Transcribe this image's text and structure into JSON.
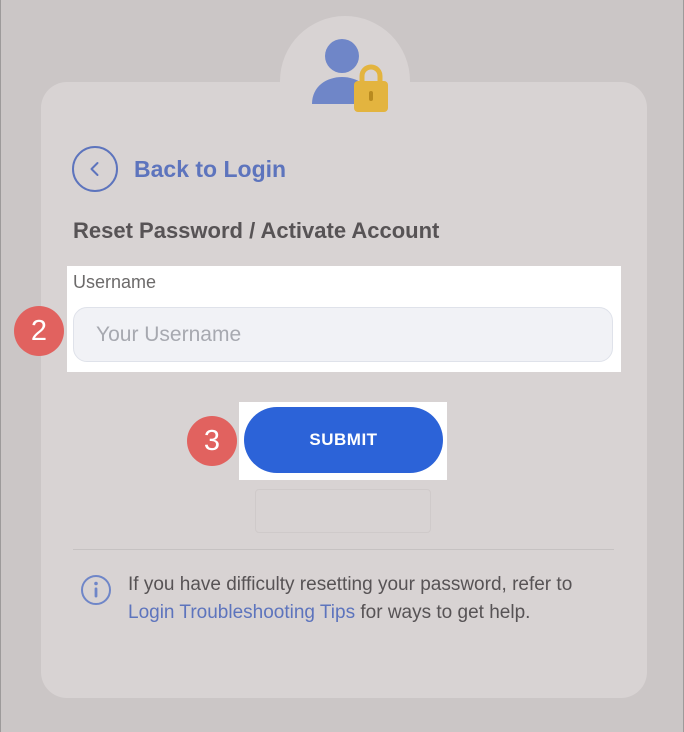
{
  "back_link": {
    "label": "Back to Login"
  },
  "page_title": "Reset Password / Activate Account",
  "username_field": {
    "label": "Username",
    "placeholder": "Your Username",
    "value": ""
  },
  "submit_button": {
    "label": "SUBMIT"
  },
  "step_badges": {
    "username": "2",
    "submit": "3"
  },
  "help_note": {
    "text_before": "If you have difficulty resetting your password, refer to ",
    "link_text": "Login Troubleshooting Tips",
    "text_after": " for ways to get help."
  },
  "icons": {
    "header": "user-lock-icon",
    "back": "chevron-left-icon",
    "info": "info-icon"
  },
  "colors": {
    "accent_blue": "#2c63d8",
    "link_blue": "#5d74bd",
    "badge_red": "#e1625f",
    "lock_gold": "#e3b43f"
  }
}
